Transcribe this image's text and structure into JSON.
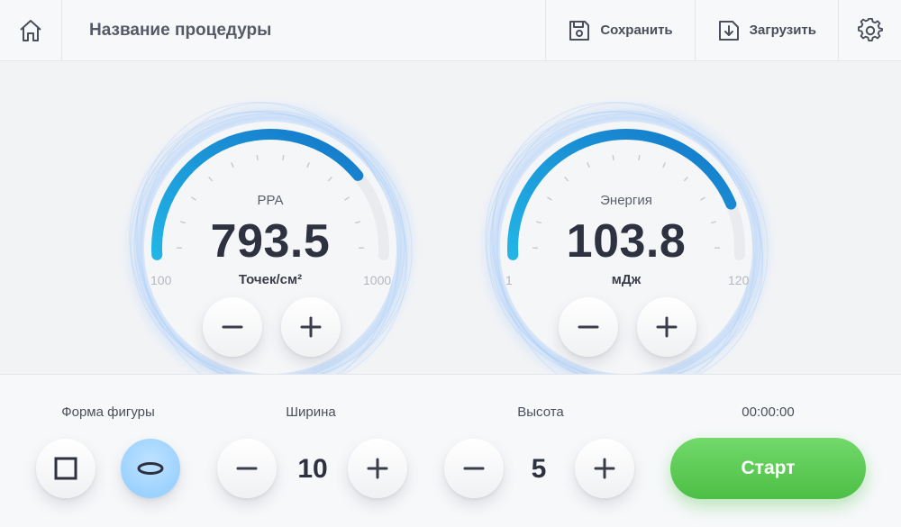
{
  "header": {
    "home_icon": "home-icon",
    "title": "Название процедуры",
    "save_label": "Сохранить",
    "load_label": "Загрузить",
    "settings_icon": "gear-icon"
  },
  "gauges": [
    {
      "label": "PPA",
      "value": "793.5",
      "unit": "Точек/см²",
      "min": "100",
      "max": "1000",
      "fill_fraction": 0.77
    },
    {
      "label": "Энергия",
      "value": "103.8",
      "unit": "мДж",
      "min": "1",
      "max": "120",
      "fill_fraction": 0.86
    }
  ],
  "bottom": {
    "shape_label": "Форма фигуры",
    "shapes": [
      "square-shape",
      "ellipse-shape"
    ],
    "selected_shape": "ellipse-shape",
    "width_label": "Ширина",
    "width_value": "10",
    "height_label": "Высота",
    "height_value": "5",
    "timer": "00:00:00",
    "start_label": "Старт"
  },
  "colors": {
    "accent": "#1a9fe0",
    "start": "#4cbf45",
    "selected": "#8ccbff"
  }
}
